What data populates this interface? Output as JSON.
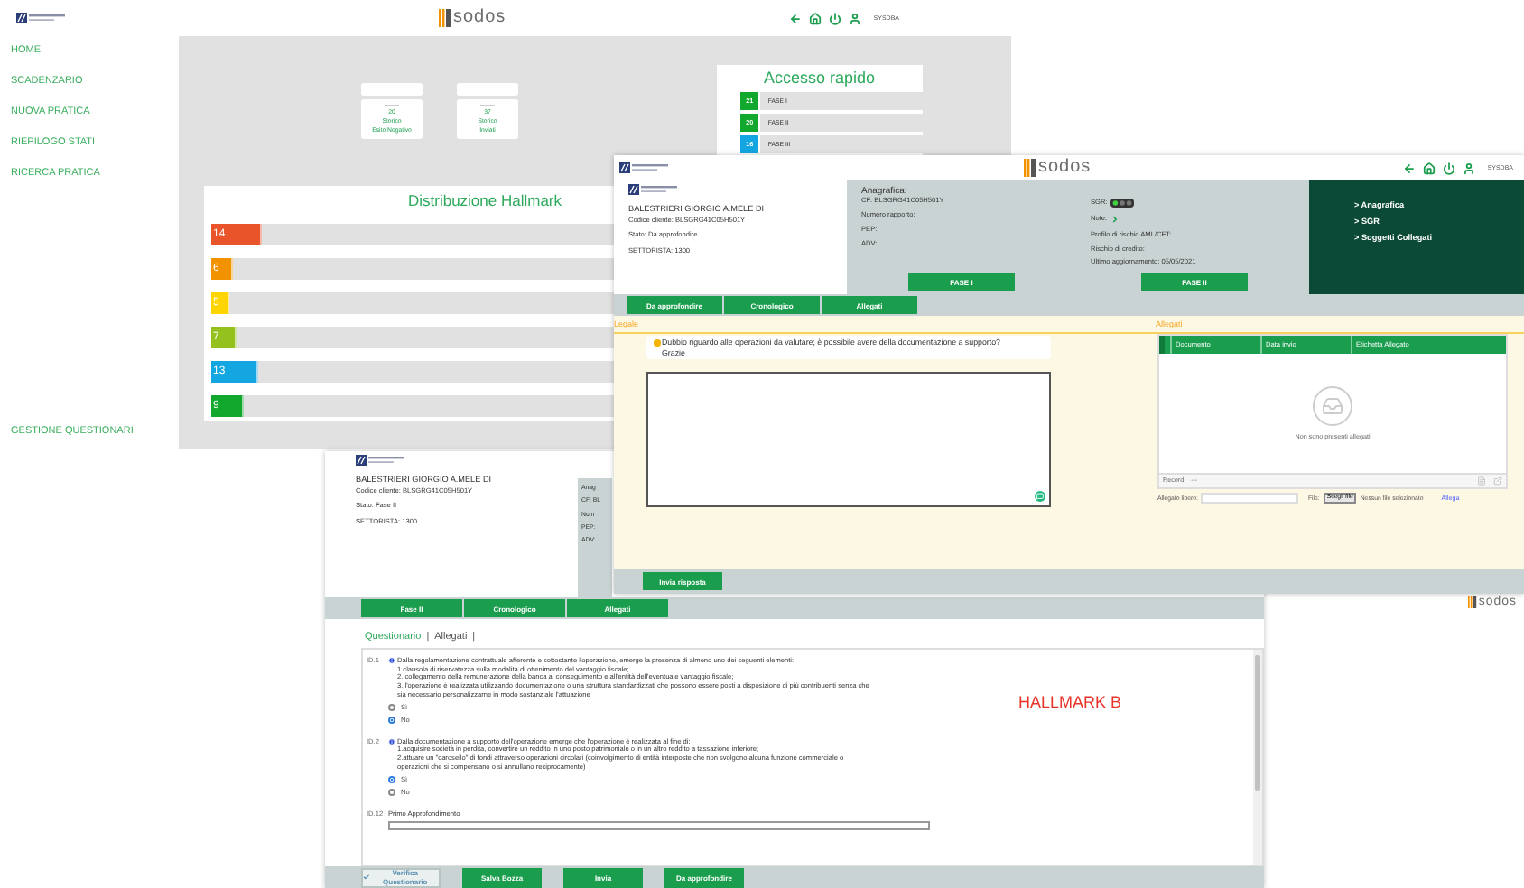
{
  "dashboard": {
    "brand": "sodos",
    "user": "SYSDBA",
    "menu": [
      {
        "label": "HOME"
      },
      {
        "label": "SCADENZARIO"
      },
      {
        "label": "NUOVA PRATICA"
      },
      {
        "label": "RIEPILOGO STATI"
      },
      {
        "label": "RICERCA PRATICA"
      }
    ],
    "menu_footer": "GESTIONE QUESTIONARI",
    "cards": [
      {
        "value": "20",
        "label": "Storico\nEsito Negativo"
      },
      {
        "value": "37",
        "label": "Storico\nInviati"
      }
    ],
    "quick_access": {
      "title": "Accesso rapido",
      "items": [
        {
          "count": "21",
          "label": "FASE I",
          "color": "#12a82d"
        },
        {
          "count": "20",
          "label": "FASE II",
          "color": "#12a82d"
        },
        {
          "count": "16",
          "label": "FASE III",
          "color": "#14a6e0"
        }
      ]
    },
    "hallmark": {
      "title": "Distribuzione Hallmark",
      "bars": [
        {
          "value": "14",
          "level": 0.126,
          "color": "#e9542b"
        },
        {
          "value": "6",
          "level": 0.054,
          "color": "#f39200"
        },
        {
          "value": "5",
          "level": 0.045,
          "color": "#ffd500"
        },
        {
          "value": "7",
          "level": 0.063,
          "color": "#95c11f"
        },
        {
          "value": "13",
          "level": 0.117,
          "color": "#14a6e0"
        },
        {
          "value": "9",
          "level": 0.081,
          "color": "#12a82d"
        }
      ]
    }
  },
  "detail": {
    "brand": "sodos",
    "user": "SYSDBA",
    "client": {
      "name": "BALESTRIERI GIORGIO A.MELE DI",
      "code": "Codice cliente: BLSGRG41C05H501Y",
      "status": "Stato: Da approfondire",
      "officer": "SETTORISTA: 1300"
    },
    "registry": {
      "title": "Anagrafica:",
      "left": [
        "CF: BLSGRG41C05H501Y",
        "Numero rapporto:",
        "PEP:",
        "ADV:"
      ],
      "sgr": "SGR:",
      "note": "Note:",
      "right": [
        "Profilo di rischio AML/CFT:",
        "Rischio di credito:",
        "Ultimo aggiornamento: 05/05/2021"
      ],
      "buttons": [
        "FASE I",
        "FASE II"
      ]
    },
    "links": [
      "> Anagrafica",
      "> SGR",
      "> Soggetti Collegati"
    ],
    "tabs": [
      "Da approfondire",
      "Cronologico",
      "Allegati"
    ],
    "legal": {
      "title": "Legale",
      "message": "Dubbio riguardo alle operazioni da valutare; è possibile avere della documentazione a supporto?\nGrazie"
    },
    "attachments": {
      "title": "Allegati",
      "columns": [
        "Documento",
        "Data invio",
        "Etichetta Allegato"
      ],
      "empty": "Non sono presenti allegati",
      "record": "Record",
      "record_value": "---",
      "free_label": "Allegato libero:",
      "file_label": "File:",
      "file_button": "Scegli file",
      "file_status": "Nessun file selezionato",
      "attach_link": "Allega"
    },
    "reply_button": "Invia risposta"
  },
  "questionnaire": {
    "client": {
      "name": "BALESTRIERI GIORGIO A.MELE DI",
      "code": "Codice cliente: BLSGRG41C05H501Y",
      "status": "Stato: Fase II",
      "officer": "SETTORISTA: 1300"
    },
    "registry_partial": [
      "Anag",
      "CF: BL",
      "Num",
      "PEP:",
      "ADV:"
    ],
    "tabs": [
      "Fase II",
      "Cronologico",
      "Allegati"
    ],
    "subtabs": [
      {
        "label": "Questionario",
        "selected": true,
        "separator": "|"
      },
      {
        "label": "Allegati",
        "selected": false,
        "separator": "|"
      }
    ],
    "questions": [
      {
        "kind": "choice",
        "id": "ID.1",
        "text": "Dalla regolamentazione contrattuale afferente e sottostante l'operazione, emerge la presenza di almeno uno dei seguenti elementi:\n1.clausola di riservatezza sulla modalità di ottenimento del vantaggio fiscale;\n2. collegamento della remunerazione della banca al conseguimento e all'entità dell'eventuale vantaggio fiscale;\n3. l'operazione è realizzata utilizzando documentazione o una struttura standardizzati che possono essere posti a disposizione di più contribuenti senza che\nsia necessario personalizzarne in modo sostanziale l'attuazione",
        "options": [
          {
            "label": "Sì",
            "selected": false
          },
          {
            "label": "No",
            "selected": true
          }
        ]
      },
      {
        "kind": "choice",
        "id": "ID.2",
        "text": "Dalla documentazione a supporto dell'operazione emerge che l'operazione è realizzata al fine di:\n1.acquisire società in perdita, convertire un reddito in uno posto patrimoniale o in un altro reddito a tassazione inferiore;\n2.attuare un \"carosello\" di fondi attraverso operazioni circolari (coinvolgimento di entità interposte che non svolgono alcuna funzione commerciale o\noperazioni che si compensano o si annullano reciprocamente)",
        "options": [
          {
            "label": "Sì",
            "selected": true
          },
          {
            "label": "No",
            "selected": false
          }
        ]
      },
      {
        "kind": "text",
        "id": "ID.12",
        "text": "Primo Approfondimento"
      }
    ],
    "stamp": "HALLMARK B",
    "footer": [
      {
        "label": "Verifica Questionario",
        "disabled": true
      },
      {
        "label": "Salva Bozza",
        "disabled": false
      },
      {
        "label": "Invia",
        "disabled": false
      },
      {
        "label": "Da approfondire",
        "disabled": false
      }
    ]
  },
  "corner": {
    "brand": "sodos"
  }
}
